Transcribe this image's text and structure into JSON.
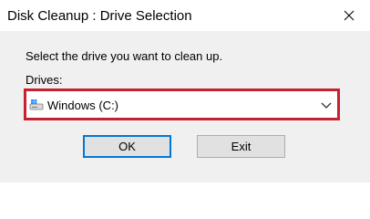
{
  "window": {
    "title": "Disk Cleanup : Drive Selection"
  },
  "dialog": {
    "prompt": "Select the drive you want to clean up.",
    "drives_label": "Drives:",
    "drive_select": {
      "selected": "Windows (C:)",
      "icon": "windows-drive-icon"
    }
  },
  "buttons": {
    "ok_label": "OK",
    "exit_label": "Exit"
  },
  "colors": {
    "highlight_border": "#c8202f",
    "focus_border": "#0078d7"
  }
}
